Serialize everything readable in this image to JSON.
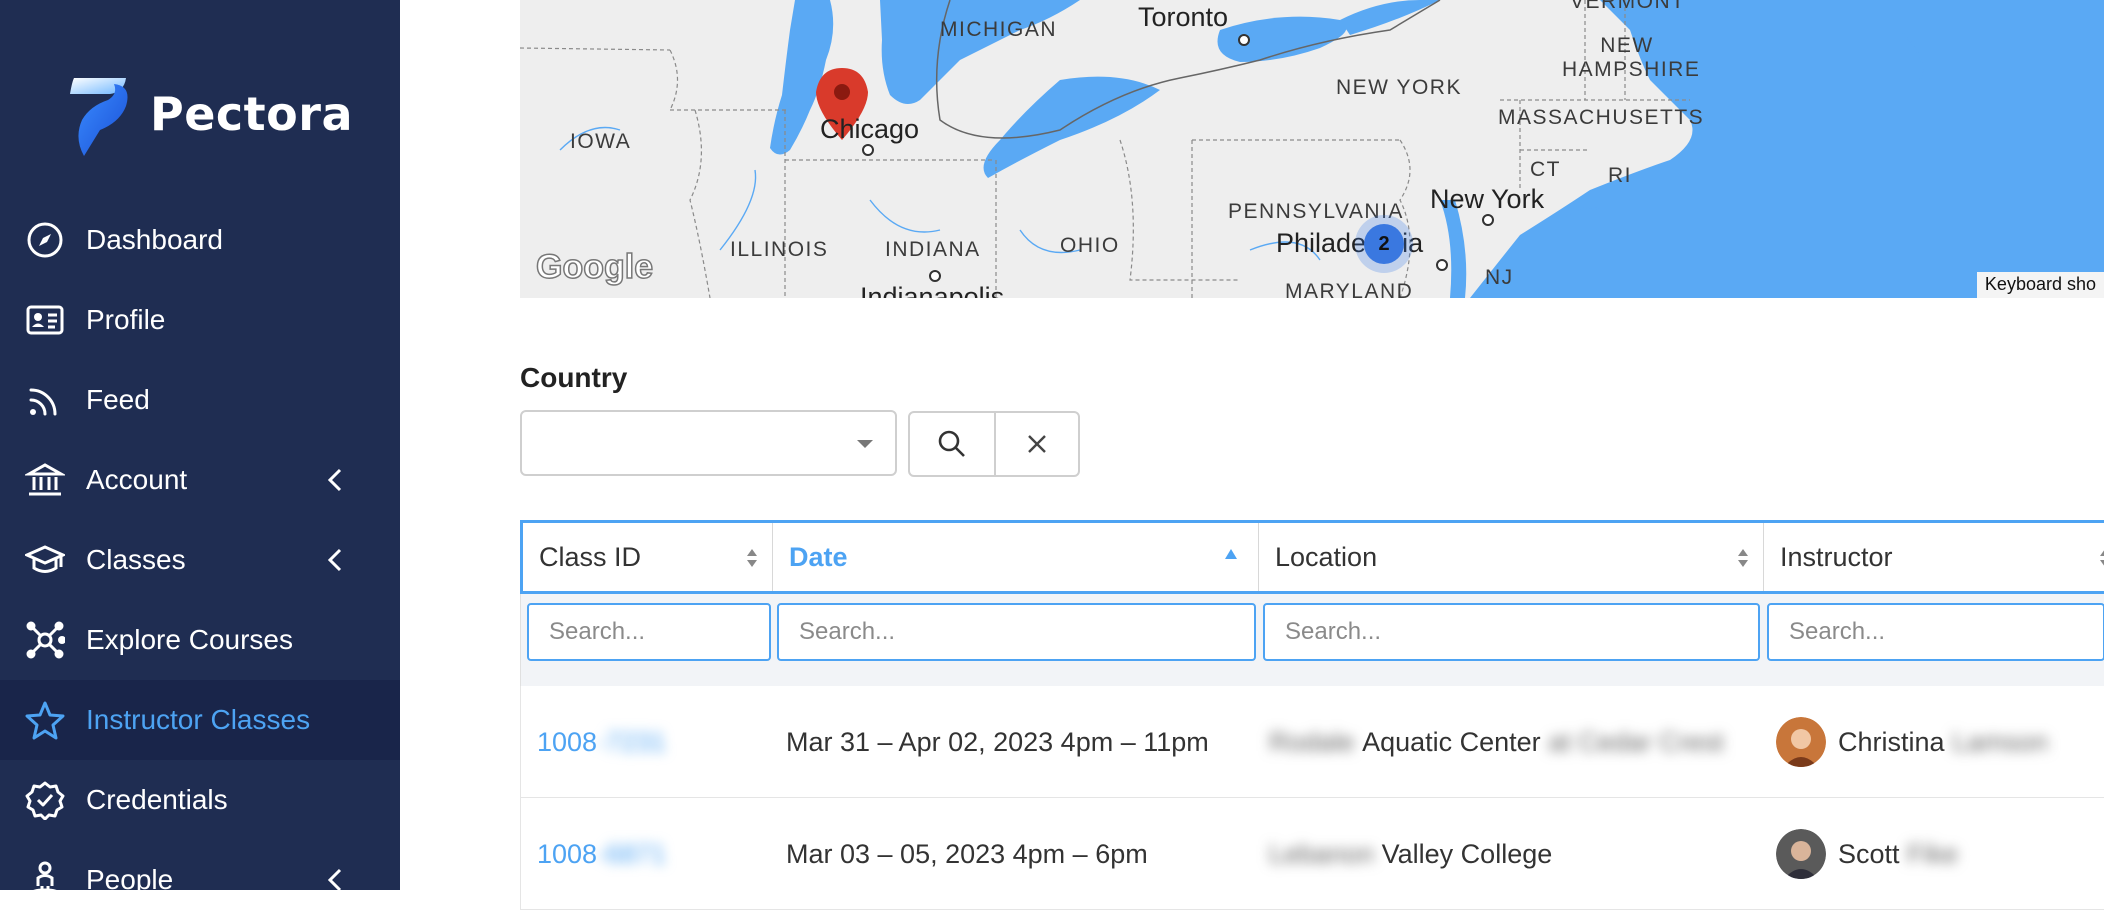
{
  "app": {
    "name": "Pectora"
  },
  "sidebar": {
    "items": [
      {
        "label": "Dashboard",
        "icon": "compass-icon",
        "expandable": false,
        "active": false
      },
      {
        "label": "Profile",
        "icon": "id-card-icon",
        "expandable": false,
        "active": false
      },
      {
        "label": "Feed",
        "icon": "rss-icon",
        "expandable": false,
        "active": false
      },
      {
        "label": "Account",
        "icon": "bank-icon",
        "expandable": true,
        "active": false
      },
      {
        "label": "Classes",
        "icon": "graduation-cap-icon",
        "expandable": true,
        "active": false
      },
      {
        "label": "Explore Courses",
        "icon": "network-icon",
        "expandable": false,
        "active": false
      },
      {
        "label": "Instructor Classes",
        "icon": "star-icon",
        "expandable": false,
        "active": true
      },
      {
        "label": "Credentials",
        "icon": "badge-check-icon",
        "expandable": false,
        "active": false
      },
      {
        "label": "People",
        "icon": "person-pin-icon",
        "expandable": true,
        "active": false
      }
    ]
  },
  "map": {
    "regions": [
      "MICHIGAN",
      "IOWA",
      "ILLINOIS",
      "INDIANA",
      "OHIO",
      "PENNSYLVANIA",
      "MARYLAND",
      "NEW YORK",
      "NEW HAMPSHIRE",
      "MASSACHUSETTS",
      "CT",
      "RI",
      "NJ",
      "VERMONT"
    ],
    "cities": [
      "Toronto",
      "Chicago",
      "New York",
      "Philadelphia",
      "Indianapolis"
    ],
    "cluster_count": "2",
    "attribution": "Google",
    "keyboard_label": "Keyboard sho",
    "colors": {
      "water": "#5aa9f4",
      "land": "#eeeeee",
      "marker": "#d93a2b"
    }
  },
  "filter": {
    "label": "Country",
    "select_value": "",
    "search_icon": "search-icon",
    "clear_icon": "close-icon"
  },
  "table": {
    "columns": [
      {
        "label": "Class ID",
        "sorted": false
      },
      {
        "label": "Date",
        "sorted": true,
        "direction": "asc"
      },
      {
        "label": "Location",
        "sorted": false
      },
      {
        "label": "Instructor",
        "sorted": false
      }
    ],
    "search_placeholder": "Search...",
    "rows": [
      {
        "class_id": "1008",
        "class_id_hidden": "-7231",
        "date": "Mar 31 – Apr 02, 2023 4pm – 11pm",
        "location_hidden_pre": "Rodale",
        "location": "Aquatic Center",
        "location_hidden_post": "at Cedar Crest",
        "instructor": "Christina",
        "instructor_hidden": "Lamson"
      },
      {
        "class_id": "1008",
        "class_id_hidden": "-6871",
        "date": "Mar 03 – 05, 2023 4pm – 6pm",
        "location_hidden_pre": "Lebanon",
        "location": "Valley College",
        "location_hidden_post": "",
        "instructor": "Scott",
        "instructor_hidden": "Fike"
      }
    ]
  },
  "colors": {
    "sidebar_bg": "#1f2d52",
    "accent": "#4da3f3"
  }
}
